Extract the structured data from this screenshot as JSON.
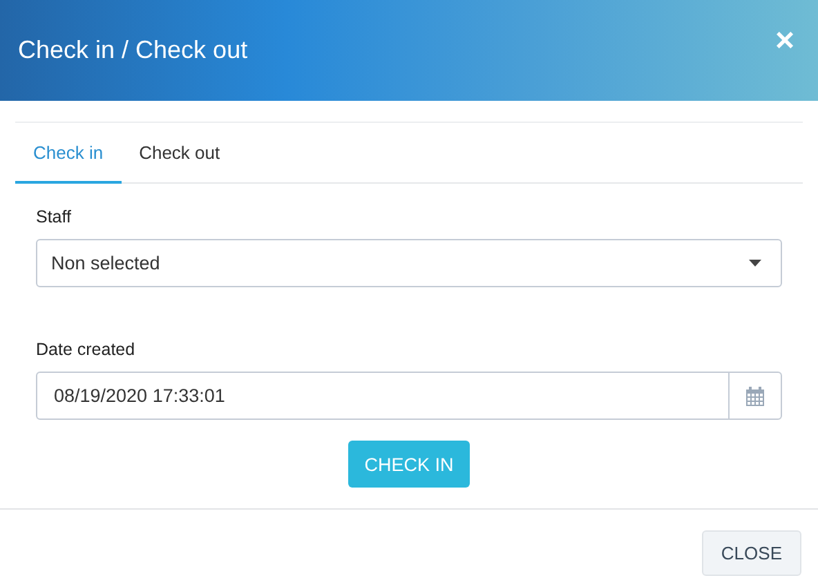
{
  "window": {
    "title": "Check in / Check out",
    "close": "×"
  },
  "tabs": [
    {
      "label": "Check in",
      "selected": true
    },
    {
      "label": "Check out",
      "selected": false
    }
  ],
  "form": {
    "staff": {
      "label": "Staff",
      "value": "Non selected"
    },
    "date_created": {
      "label": "Date created",
      "value": "08/19/2020 17:33:01"
    }
  },
  "submit": "CHECK IN",
  "footer_button": "CLOSE"
}
